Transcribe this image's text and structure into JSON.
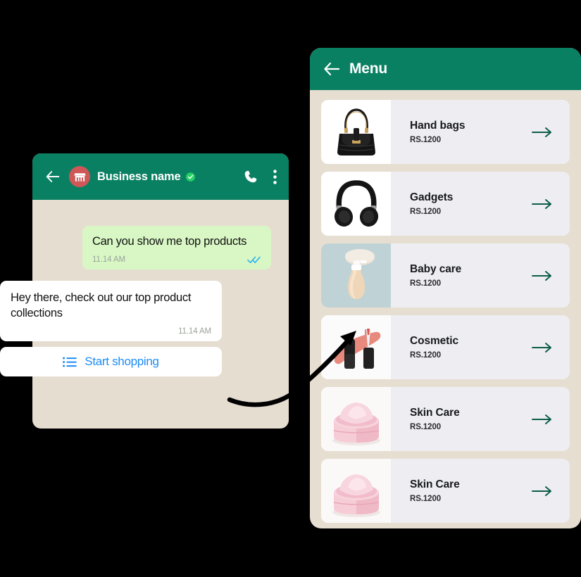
{
  "colors": {
    "brand_green": "#0a8063",
    "panel_beige": "#e6ded1",
    "card_grey": "#eeeef2",
    "arrow_green": "#0d5c48",
    "outgoing_bubble": "#d9f7c5",
    "link_blue": "#1c8cf5",
    "verified_green": "#25d366",
    "avatar_red": "#cf5757",
    "tick_blue": "#34b7f1",
    "page_background": "#000000"
  },
  "catalog": {
    "header": {
      "title": "Menu",
      "back_icon": "arrow-left-icon"
    },
    "items": [
      {
        "title": "Hand bags",
        "price": "RS.1200",
        "thumb": "handbag-image",
        "arrow_icon": "arrow-right-icon"
      },
      {
        "title": "Gadgets",
        "price": "RS.1200",
        "thumb": "headphones-image",
        "arrow_icon": "arrow-right-icon"
      },
      {
        "title": "Baby care",
        "price": "RS.1200",
        "thumb": "lotion-image",
        "arrow_icon": "arrow-right-icon"
      },
      {
        "title": "Cosmetic",
        "price": "RS.1200",
        "thumb": "lipgloss-image",
        "arrow_icon": "arrow-right-icon"
      },
      {
        "title": "Skin Care",
        "price": "RS.1200",
        "thumb": "cream-jar-image",
        "arrow_icon": "arrow-right-icon"
      },
      {
        "title": "Skin Care",
        "price": "RS.1200",
        "thumb": "cream-jar-image",
        "arrow_icon": "arrow-right-icon"
      }
    ]
  },
  "chat": {
    "header": {
      "back_icon": "arrow-left-icon",
      "avatar_icon": "storefront-icon",
      "business_name": "Business name",
      "verified_icon": "verified-badge-icon",
      "call_icon": "phone-icon",
      "overflow_icon": "more-vertical-icon"
    },
    "messages": [
      {
        "direction": "outgoing",
        "text": "Can you show me top products",
        "time": "11.14 AM",
        "status_icon": "double-check-icon"
      },
      {
        "direction": "incoming",
        "text": "Hey there, check out our top product collections",
        "time": "11.14 AM"
      }
    ],
    "action_button": {
      "label": "Start shopping",
      "icon": "list-menu-icon"
    }
  },
  "annotation": {
    "arrow_icon": "curved-arrow-icon"
  }
}
